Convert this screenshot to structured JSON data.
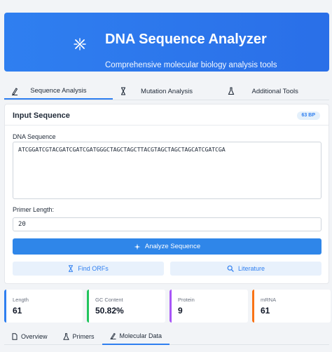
{
  "header": {
    "title": "DNA Sequence Analyzer",
    "subtitle": "Comprehensive molecular biology analysis tools",
    "logo_icon": "dna-icon"
  },
  "tabs": [
    {
      "label": "Sequence Analysis",
      "icon": "pen-icon",
      "active": true
    },
    {
      "label": "Mutation Analysis",
      "icon": "hourglass-icon",
      "active": false
    },
    {
      "label": "Additional Tools",
      "icon": "flask-icon",
      "active": false
    }
  ],
  "input_card": {
    "title": "Input Sequence",
    "badge": "63 BP",
    "sequence_label": "DNA Sequence",
    "sequence_value": "ATCGGATCGTACGATCGATCGATGGGCTAGCTAGCTTACGTAGCTAGCTAGCATCGATCGA",
    "primer_label": "Primer Length:",
    "primer_value": "20",
    "analyze_label": "Analyze Sequence",
    "find_orfs_label": "Find ORFs",
    "literature_label": "Literature"
  },
  "stats": [
    {
      "label": "Length",
      "value": "61",
      "color": "#2f7ff0"
    },
    {
      "label": "GC Content",
      "value": "50.82%",
      "color": "#22c55e"
    },
    {
      "label": "Protein",
      "value": "9",
      "color": "#a855f7"
    },
    {
      "label": "mRNA",
      "value": "61",
      "color": "#f97316"
    }
  ],
  "subtabs": [
    {
      "label": "Overview",
      "icon": "document-icon",
      "active": false
    },
    {
      "label": "Primers",
      "icon": "flask-icon",
      "active": false
    },
    {
      "label": "Molecular Data",
      "icon": "pen-icon",
      "active": true
    }
  ],
  "colors": {
    "accent": "#2f7ff0",
    "header_bg": "#2f7ff0",
    "secondary_button_bg": "#e8f1fc"
  }
}
